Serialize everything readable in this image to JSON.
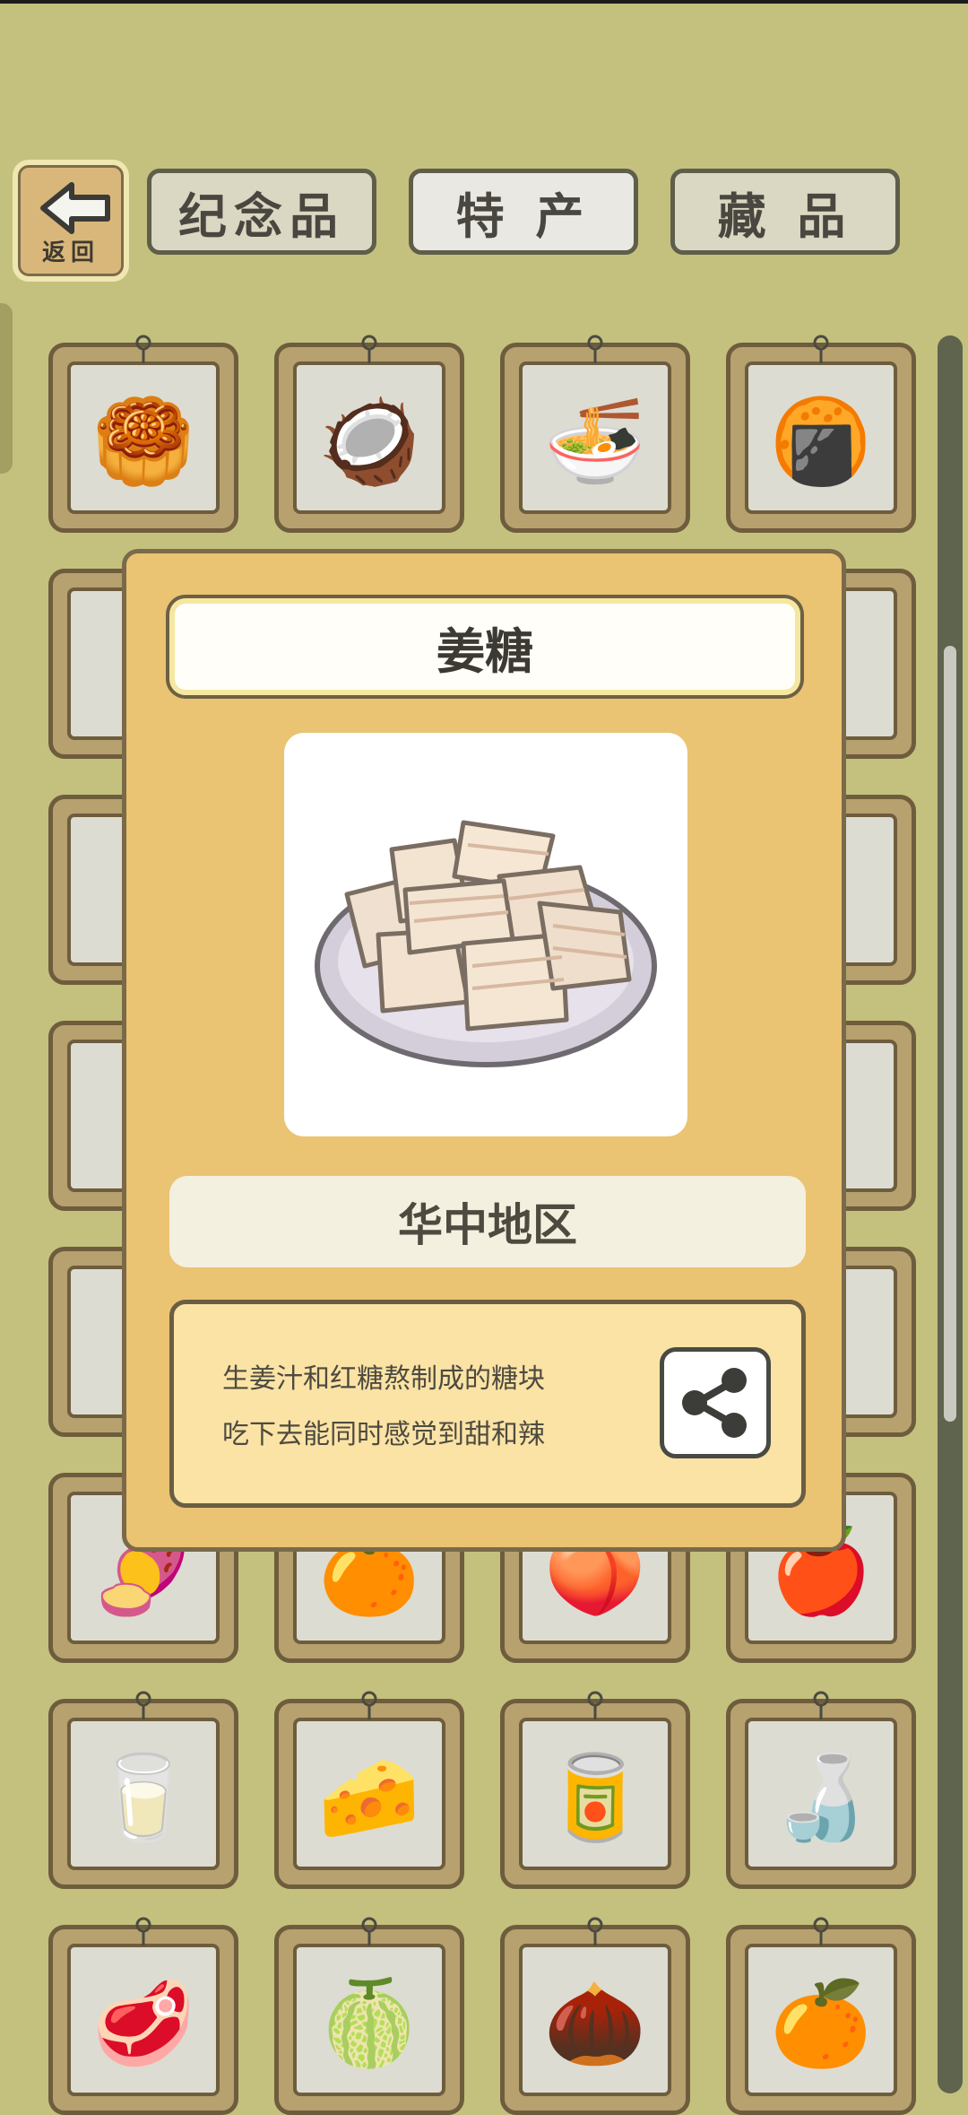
{
  "header": {
    "back_label": "返回",
    "tabs": [
      {
        "label": "纪念品",
        "active": false
      },
      {
        "label": "特 产",
        "active": true
      },
      {
        "label": "藏 品",
        "active": false
      }
    ]
  },
  "grid": {
    "items": [
      {
        "icon": "mooncake-icon",
        "glyph": "🥮"
      },
      {
        "icon": "coconut-icon",
        "glyph": "🥥"
      },
      {
        "icon": "noodle-bowl-icon",
        "glyph": "🍜"
      },
      {
        "icon": "ginger-candy-plate-icon",
        "glyph": "🍘"
      },
      {
        "icon": "sweet-potato-icon",
        "glyph": "🍠"
      },
      {
        "icon": "orange-icon",
        "glyph": "🍊"
      },
      {
        "icon": "peach-icon",
        "glyph": "🍑"
      },
      {
        "icon": "apple-icon",
        "glyph": "🍎"
      },
      {
        "icon": "milk-jug-icon",
        "glyph": "🥛"
      },
      {
        "icon": "cheese-icon",
        "glyph": "🧀"
      },
      {
        "icon": "tea-can-icon",
        "glyph": "🥫"
      },
      {
        "icon": "bottle-icon",
        "glyph": "🍶"
      },
      {
        "icon": "dried-meat-bowl-icon",
        "glyph": "🥩"
      },
      {
        "icon": "durian-icon",
        "glyph": "🍈"
      },
      {
        "icon": "longan-icon",
        "glyph": "🌰"
      },
      {
        "icon": "orange-slice-icon",
        "glyph": "🍊"
      }
    ]
  },
  "modal": {
    "title": "姜糖",
    "region": "华中地区",
    "description_lines": [
      "生姜汁和红糖熬制成的糖块",
      "吃下去能同时感觉到甜和辣"
    ]
  },
  "colors": {
    "background": "#c4c07e",
    "modal": "#eac373",
    "card_frame": "#b6a16f",
    "card_inner": "#dcdcd2"
  }
}
